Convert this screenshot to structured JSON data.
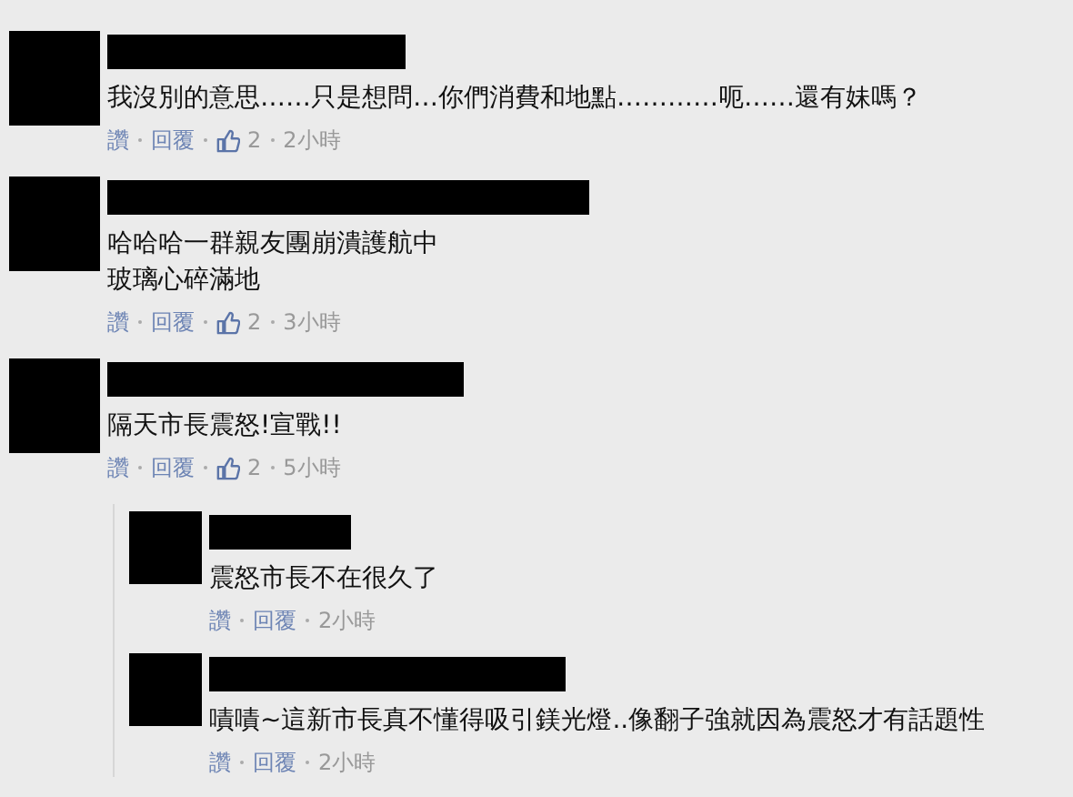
{
  "comments": [
    {
      "lines": [
        "我沒別的意思……只是想問…你們消費和地點…………呃……還有妹嗎？"
      ],
      "like": "讚",
      "reply": "回覆",
      "likes": "2",
      "time": "2小時"
    },
    {
      "lines": [
        "哈哈哈一群親友團崩潰護航中",
        "玻璃心碎滿地"
      ],
      "like": "讚",
      "reply": "回覆",
      "likes": "2",
      "time": "3小時"
    },
    {
      "lines": [
        "隔天市長震怒!宣戰!!"
      ],
      "like": "讚",
      "reply": "回覆",
      "likes": "2",
      "time": "5小時",
      "replies": [
        {
          "lines": [
            "震怒市長不在很久了"
          ],
          "like": "讚",
          "reply": "回覆",
          "time": "2小時"
        },
        {
          "lines": [
            "嘖嘖~這新市長真不懂得吸引鎂光燈..像翻子強就因為震怒才有話題性"
          ],
          "like": "讚",
          "reply": "回覆",
          "time": "2小時"
        }
      ]
    }
  ]
}
